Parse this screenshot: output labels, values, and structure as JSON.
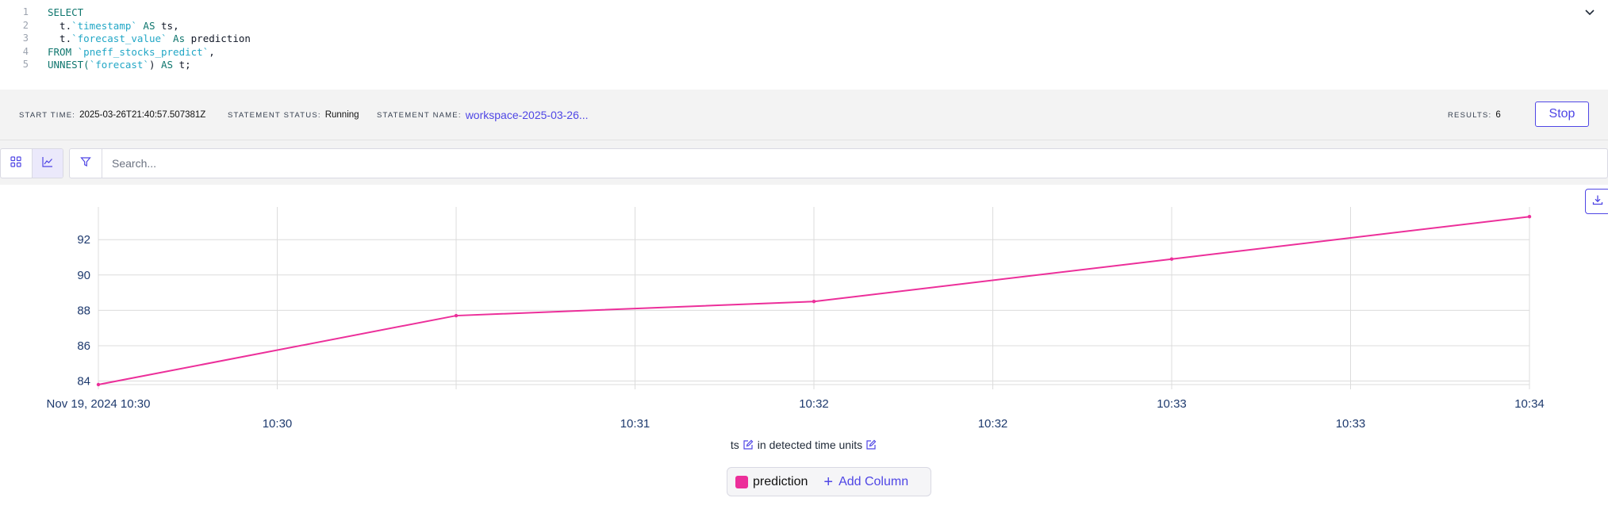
{
  "editor": {
    "lines": [
      {
        "n": "1",
        "tokens": [
          {
            "t": "SELECT",
            "c": "kw"
          }
        ]
      },
      {
        "n": "2",
        "tokens": [
          {
            "t": "  t.",
            "c": ""
          },
          {
            "t": "`timestamp`",
            "c": "str"
          },
          {
            "t": " AS ",
            "c": "kw"
          },
          {
            "t": "ts,",
            "c": ""
          }
        ]
      },
      {
        "n": "3",
        "tokens": [
          {
            "t": "  t.",
            "c": ""
          },
          {
            "t": "`forecast_value`",
            "c": "str"
          },
          {
            "t": " As ",
            "c": "kw"
          },
          {
            "t": "prediction",
            "c": ""
          }
        ]
      },
      {
        "n": "4",
        "tokens": [
          {
            "t": "FROM ",
            "c": "kw"
          },
          {
            "t": "`pneff_stocks_predict`",
            "c": "str"
          },
          {
            "t": ",",
            "c": ""
          }
        ]
      },
      {
        "n": "5",
        "tokens": [
          {
            "t": "UNNEST(",
            "c": "kw"
          },
          {
            "t": "`forecast`",
            "c": "str"
          },
          {
            "t": ") ",
            "c": ""
          },
          {
            "t": "AS ",
            "c": "kw"
          },
          {
            "t": "t;",
            "c": ""
          }
        ]
      }
    ]
  },
  "statement": {
    "start_time_label": "START TIME:",
    "start_time": "2025-03-26T21:40:57.507381Z",
    "status_label": "STATEMENT STATUS:",
    "status": "Running",
    "name_label": "STATEMENT NAME:",
    "name": "workspace-2025-03-26...",
    "results_label": "RESULTS:",
    "results": "6",
    "stop_label": "Stop"
  },
  "toolbar": {
    "search_placeholder": "Search..."
  },
  "chart_data": {
    "type": "line",
    "xlabel_prefix": "ts",
    "xlabel_suffix": "in detected time units",
    "ylim": [
      83.8,
      93.4
    ],
    "y_ticks": [
      "84",
      "86",
      "88",
      "90",
      "92"
    ],
    "x_ticks_primary": [
      "Nov 19, 2024 10:30",
      "10:32",
      "10:33",
      "10:34"
    ],
    "x_ticks_secondary": [
      "10:30",
      "10:31",
      "10:32",
      "10:33"
    ],
    "grid": true,
    "series": [
      {
        "name": "prediction",
        "color": "#ec2f9a",
        "x": [
          "2024-11-19 10:30:00",
          "2024-11-19 10:31:00",
          "2024-11-19 10:32:00",
          "2024-11-19 10:33:00",
          "2024-11-19 10:34:00"
        ],
        "values": [
          83.8,
          87.7,
          88.5,
          90.9,
          93.3
        ]
      }
    ]
  },
  "legend": {
    "series_label": "prediction",
    "series_color": "#ec2f9a",
    "add_column_label": "Add Column"
  },
  "colors": {
    "accent": "#4f46e5",
    "grid": "#dcdcdc",
    "axis_text": "#1e3a6e"
  }
}
